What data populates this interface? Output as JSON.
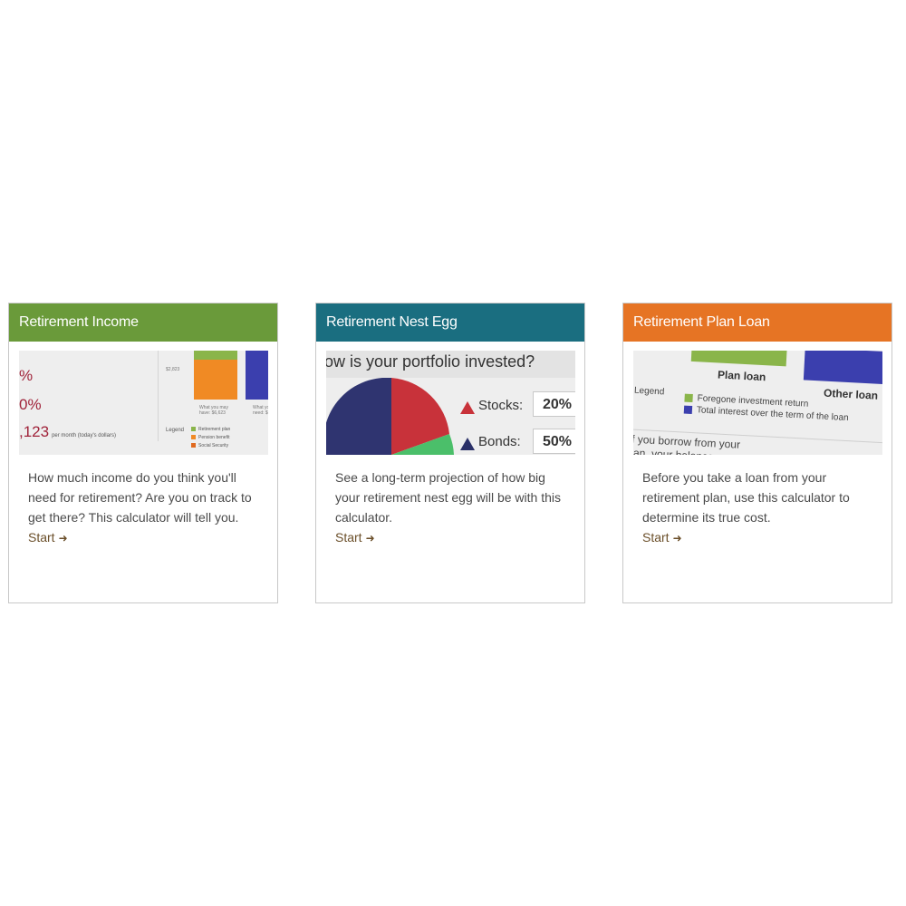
{
  "cards": [
    {
      "title": "Retirement Income",
      "header_color": "#6a9a3a",
      "description": "How much income do you think you'll need for retirement? Are you on track to get there? This calculator will tell you.",
      "link_label": "Start",
      "thumbnail": {
        "values": [
          "%",
          "0%",
          ",123"
        ],
        "per_month_note": "per month (today's dollars)",
        "axis_tick": "$2,823",
        "bar_caption_1": "What you may have: $6,623",
        "bar_caption_2": "What yo need: $6,",
        "legend_label": "Legend",
        "legend_items": [
          "Retirement plan",
          "Pension benefit",
          "Social Security"
        ],
        "colors": {
          "green": "#8ab54a",
          "orange": "#f08a24",
          "blue": "#3b3fae"
        }
      }
    },
    {
      "title": "Retirement Nest Egg",
      "header_color": "#1a6e80",
      "description": "See a long-term projection of how big your retirement nest egg will be with this calculator.",
      "link_label": "Start",
      "thumbnail": {
        "question": "ow is your portfolio invested?",
        "rows": [
          {
            "label": "Stocks:",
            "value": "20%",
            "color": "#c8323a"
          },
          {
            "label": "Bonds:",
            "value": "50%",
            "color": "#2a3068"
          }
        ],
        "pie_colors": {
          "navy": "#2f3470",
          "red": "#c8323a",
          "green": "#4bbf6a"
        }
      }
    },
    {
      "title": "Retirement Plan Loan",
      "header_color": "#e67424",
      "description": "Before you take a loan from your retirement plan, use this calculator to determine its true cost.",
      "link_label": "Start",
      "thumbnail": {
        "column_1": "Plan loan",
        "column_2": "Other loan",
        "legend_label": "Legend",
        "legend_items": [
          "Foregone investment return",
          "Total interest over the term of the loan"
        ],
        "text_line_1": "f you borrow from your",
        "text_line_2": "lan, your balance",
        "colors": {
          "green": "#8ab54a",
          "blue": "#3b3fae"
        }
      }
    }
  ]
}
